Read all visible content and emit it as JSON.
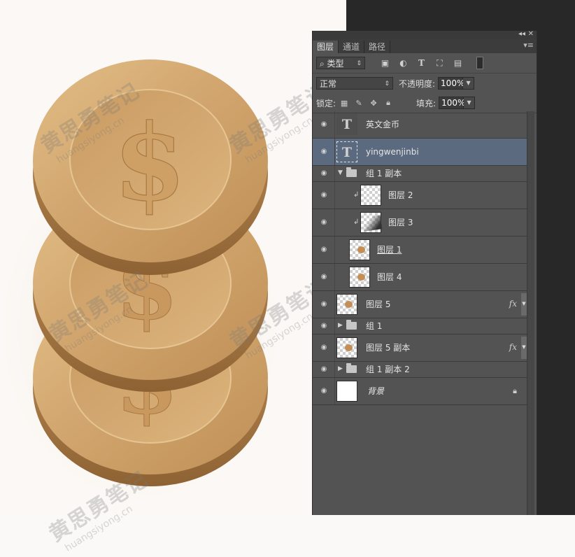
{
  "panel": {
    "tabs": [
      {
        "label": "图层",
        "active": true
      },
      {
        "label": "通道",
        "active": false
      },
      {
        "label": "路径",
        "active": false
      }
    ],
    "collapse_glyph": "◂◂",
    "close_glyph": "✕",
    "menu_glyph": "▾≡",
    "filter": {
      "kind_label": "类型",
      "icons": [
        "image-filter-icon",
        "adjustment-filter-icon",
        "type-filter-icon",
        "shape-filter-icon",
        "smart-object-filter-icon",
        "filter-toggle-icon"
      ]
    },
    "blend_mode": "正常",
    "opacity_label": "不透明度:",
    "opacity_value": "100%",
    "lock_label": "锁定:",
    "fill_label": "填充:",
    "fill_value": "100%"
  },
  "layers": [
    {
      "name": "英文金币",
      "kind": "text",
      "selected": false
    },
    {
      "name": "yingwenjinbi",
      "kind": "text",
      "selected": true
    },
    {
      "name": "组 1 副本",
      "kind": "group",
      "expanded": true
    },
    {
      "name": "图层 2",
      "kind": "pixel",
      "clipped": true
    },
    {
      "name": "图层 3",
      "kind": "pixel",
      "clipped": true
    },
    {
      "name": "图层 1",
      "kind": "pixel"
    },
    {
      "name": "图层 4",
      "kind": "pixel"
    },
    {
      "name": "图层 5",
      "kind": "pixel",
      "fx": "fx"
    },
    {
      "name": "组 1",
      "kind": "group",
      "expanded": false
    },
    {
      "name": "图层 5 副本",
      "kind": "pixel",
      "fx": "fx"
    },
    {
      "name": "组 1 副本 2",
      "kind": "group",
      "expanded": false
    },
    {
      "name": "背景",
      "kind": "background",
      "locked": true
    }
  ],
  "watermark": {
    "cn": "黄思勇笔记",
    "en": "huangsiyong.cn"
  },
  "colors": {
    "coin": "#d3a66e",
    "panel_bg": "#535353",
    "selected": "#5c6a80"
  }
}
